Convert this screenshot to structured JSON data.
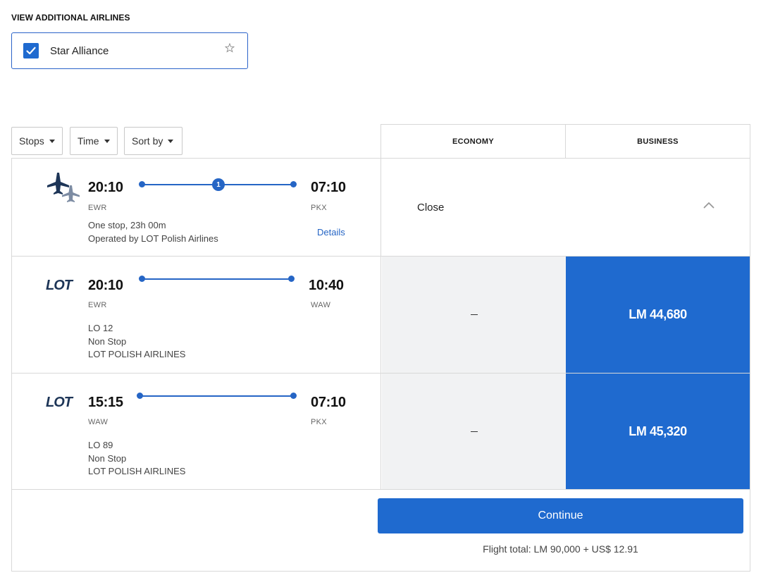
{
  "additional_airlines": {
    "section_label": "VIEW ADDITIONAL AIRLINES",
    "alliance_label": "Star Alliance",
    "checked": true
  },
  "filters": {
    "stops_label": "Stops",
    "time_label": "Time",
    "sort_label": "Sort by"
  },
  "fare_classes": {
    "economy_label": "ECONOMY",
    "business_label": "BUSINESS"
  },
  "itinerary": {
    "depart_time": "20:10",
    "depart_code": "EWR",
    "arrive_time": "07:10",
    "arrive_code": "PKX",
    "stops_count": "1",
    "duration": "One stop, 23h 00m",
    "operated_by": "Operated by LOT Polish Airlines",
    "details_label": "Details",
    "close_label": "Close"
  },
  "segments": [
    {
      "airline_logo": "LOT",
      "depart_time": "20:10",
      "depart_code": "EWR",
      "arrive_time": "10:40",
      "arrive_code": "WAW",
      "flight_number": "LO 12",
      "stop_type": "Non Stop",
      "airline_name": "LOT POLISH AIRLINES",
      "economy_price": "",
      "business_price": "LM 44,680"
    },
    {
      "airline_logo": "LOT",
      "depart_time": "15:15",
      "depart_code": "WAW",
      "arrive_time": "07:10",
      "arrive_code": "PKX",
      "flight_number": "LO 89",
      "stop_type": "Non Stop",
      "airline_name": "LOT POLISH AIRLINES",
      "economy_price": "",
      "business_price": "LM 45,320"
    }
  ],
  "footer": {
    "continue_label": "Continue",
    "flight_total": "Flight total: LM 90,000 + US$ 12.91"
  },
  "colors": {
    "accent": "#1f6acf",
    "link": "#2565c5",
    "unavailable_bg": "#f1f2f3"
  },
  "icons": {
    "checkbox": "checkmark-icon",
    "alliance": "star-alliance-logo-icon",
    "connection": "connecting-planes-icon",
    "dropdown": "caret-down-icon",
    "collapse": "chevron-up-icon"
  }
}
